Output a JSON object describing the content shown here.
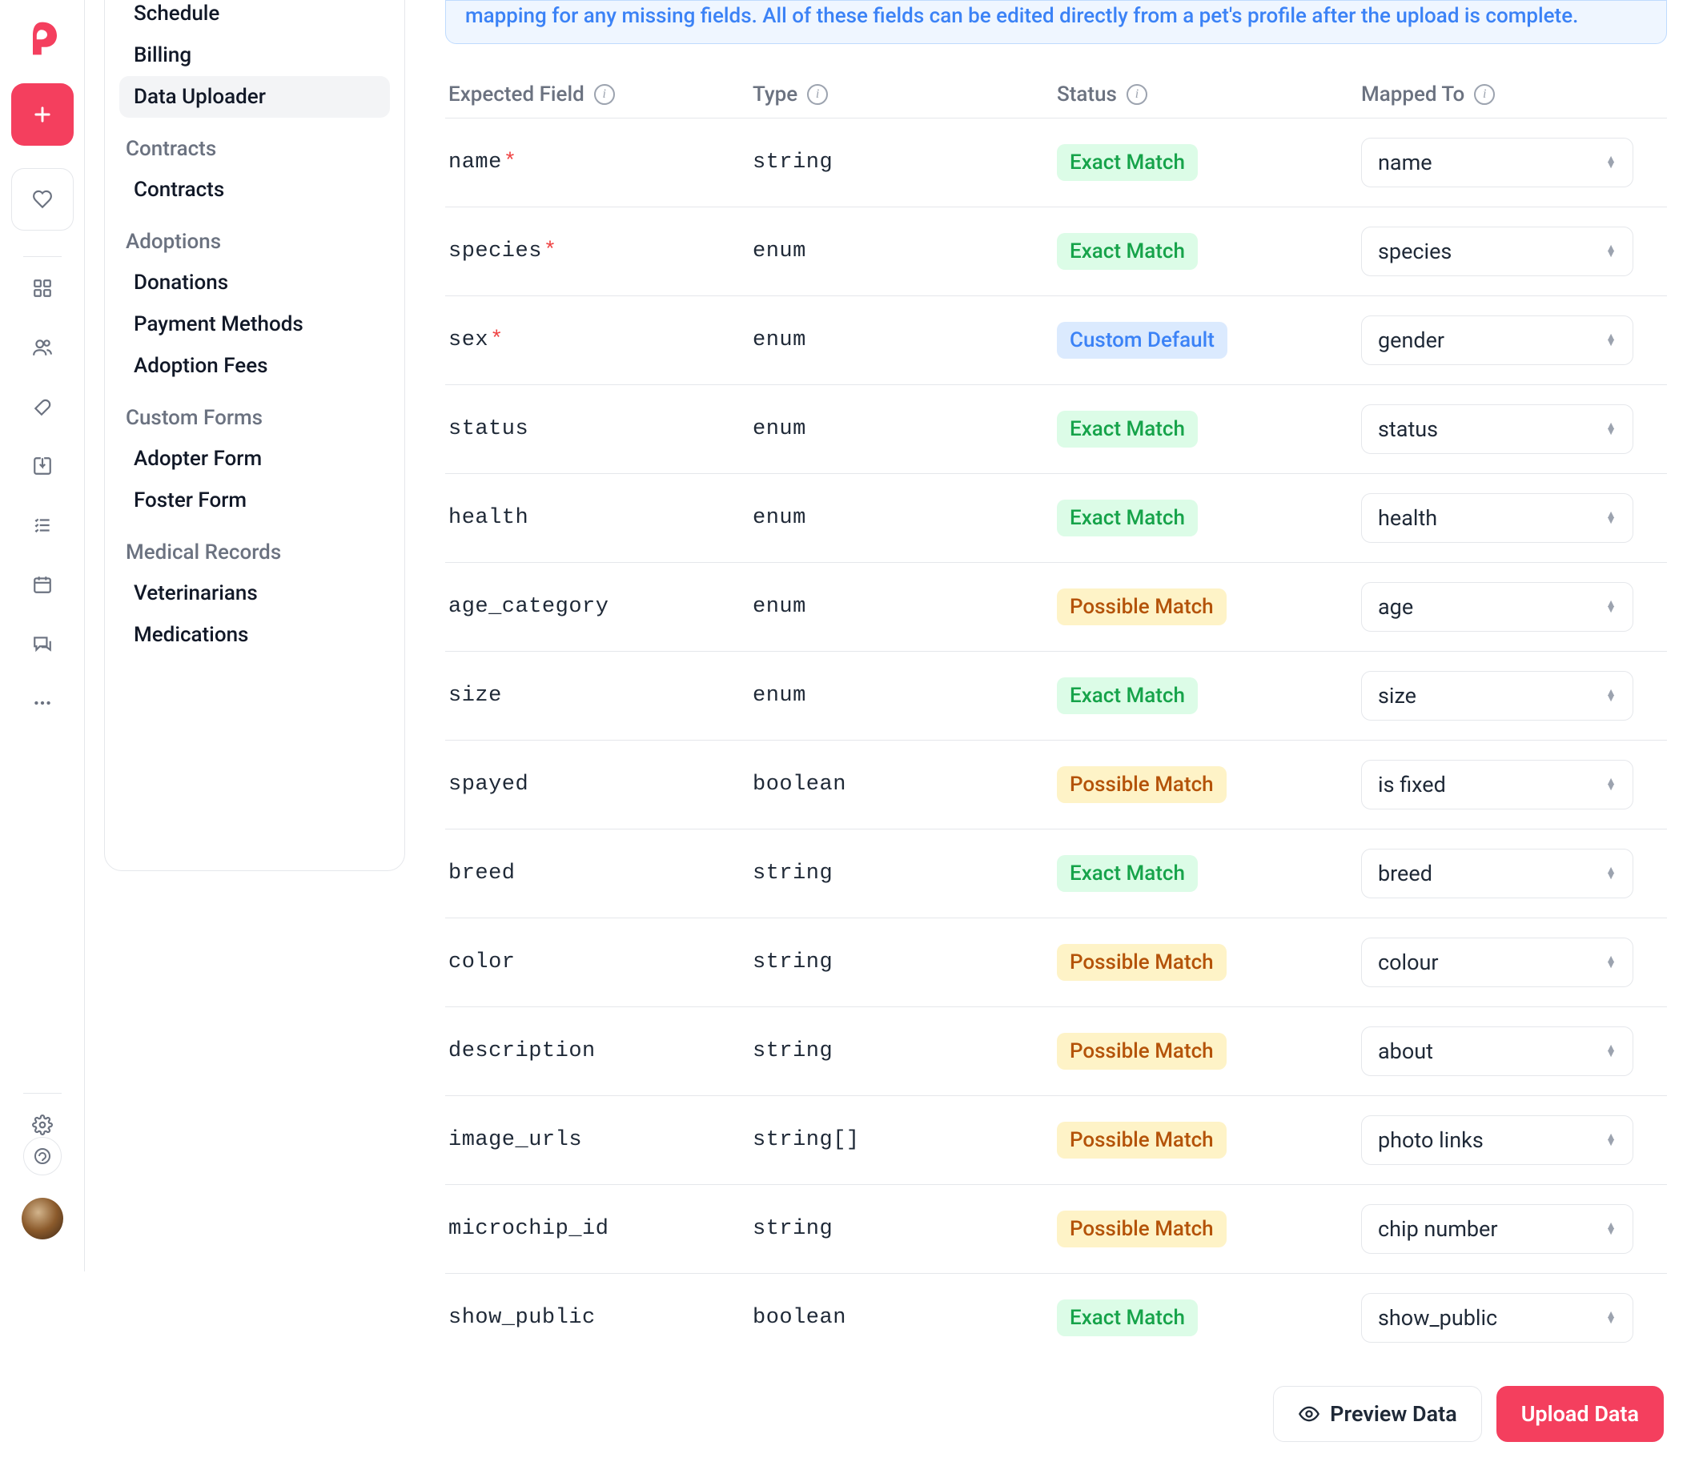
{
  "banner_text": "mapping for any missing fields. All of these fields can be edited directly from a pet's profile after the upload is complete.",
  "sidebar": {
    "top_items": [
      {
        "label": "Schedule",
        "active": false
      },
      {
        "label": "Billing",
        "active": false
      },
      {
        "label": "Data Uploader",
        "active": true
      }
    ],
    "sections": [
      {
        "heading": "Contracts",
        "items": [
          {
            "label": "Contracts"
          }
        ]
      },
      {
        "heading": "Adoptions",
        "items": [
          {
            "label": "Donations"
          },
          {
            "label": "Payment Methods"
          },
          {
            "label": "Adoption Fees"
          }
        ]
      },
      {
        "heading": "Custom Forms",
        "items": [
          {
            "label": "Adopter Form"
          },
          {
            "label": "Foster Form"
          }
        ]
      },
      {
        "heading": "Medical Records",
        "items": [
          {
            "label": "Veterinarians"
          },
          {
            "label": "Medications"
          }
        ]
      }
    ]
  },
  "columns": {
    "expected": "Expected Field",
    "type": "Type",
    "status": "Status",
    "mapped": "Mapped To"
  },
  "status_labels": {
    "exact": "Exact Match",
    "possible": "Possible Match",
    "custom": "Custom Default"
  },
  "rows": [
    {
      "field": "name",
      "required": true,
      "type": "string",
      "status": "exact",
      "mapped": "name"
    },
    {
      "field": "species",
      "required": true,
      "type": "enum",
      "status": "exact",
      "mapped": "species"
    },
    {
      "field": "sex",
      "required": true,
      "type": "enum",
      "status": "custom",
      "mapped": "gender"
    },
    {
      "field": "status",
      "required": false,
      "type": "enum",
      "status": "exact",
      "mapped": "status"
    },
    {
      "field": "health",
      "required": false,
      "type": "enum",
      "status": "exact",
      "mapped": "health"
    },
    {
      "field": "age_category",
      "required": false,
      "type": "enum",
      "status": "possible",
      "mapped": "age"
    },
    {
      "field": "size",
      "required": false,
      "type": "enum",
      "status": "exact",
      "mapped": "size"
    },
    {
      "field": "spayed",
      "required": false,
      "type": "boolean",
      "status": "possible",
      "mapped": "is fixed"
    },
    {
      "field": "breed",
      "required": false,
      "type": "string",
      "status": "exact",
      "mapped": "breed"
    },
    {
      "field": "color",
      "required": false,
      "type": "string",
      "status": "possible",
      "mapped": "colour"
    },
    {
      "field": "description",
      "required": false,
      "type": "string",
      "status": "possible",
      "mapped": "about"
    },
    {
      "field": "image_urls",
      "required": false,
      "type": "string[]",
      "status": "possible",
      "mapped": "photo links"
    },
    {
      "field": "microchip_id",
      "required": false,
      "type": "string",
      "status": "possible",
      "mapped": "chip number"
    },
    {
      "field": "show_public",
      "required": false,
      "type": "boolean",
      "status": "exact",
      "mapped": "show_public"
    }
  ],
  "actions": {
    "preview": "Preview Data",
    "upload": "Upload Data"
  }
}
